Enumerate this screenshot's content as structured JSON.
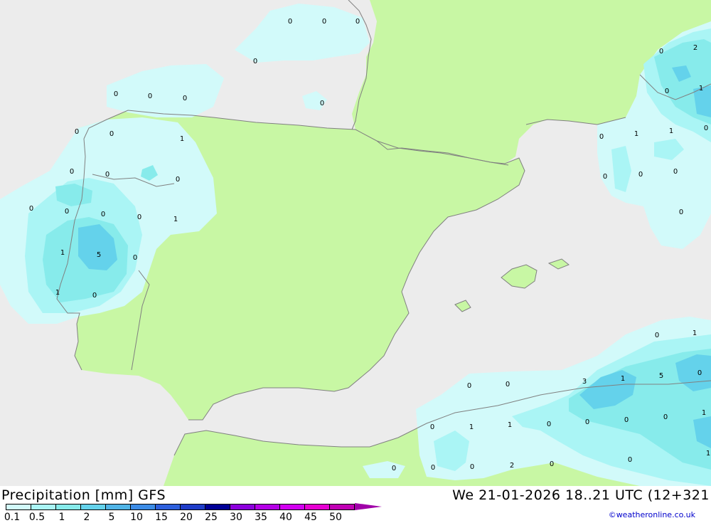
{
  "map": {
    "product_title": "Precipitation [mm] GFS",
    "valid_time": "We 21-01-2026 18..21 UTC (12+321",
    "credit": "©weatheronline.co.uk",
    "colors": {
      "sea": "#ececec",
      "land": "#c8f7a4",
      "border": "#808080",
      "precip_0_1": "#d2fafa",
      "precip_0_5": "#aaf5f5",
      "precip_1": "#87ebeb",
      "precip_2": "#64d2eb",
      "precip_5": "#50b4e6"
    },
    "legend": {
      "labels": [
        "0.1",
        "0.5",
        "1",
        "2",
        "5",
        "10",
        "15",
        "20",
        "25",
        "30",
        "35",
        "40",
        "45",
        "50"
      ],
      "colors": [
        "#d2fafa",
        "#aaf5f5",
        "#87ebeb",
        "#64d2eb",
        "#50b4e6",
        "#3c8ce6",
        "#2d5fdc",
        "#1e3cc8",
        "#000096",
        "#8c00dc",
        "#b400e6",
        "#d200f0",
        "#e600d2",
        "#c000b4"
      ]
    },
    "point_values": [
      "0",
      "0",
      "0",
      "0",
      "2",
      "0",
      "1",
      "0",
      "0",
      "0",
      "0",
      "0",
      "0",
      "0",
      "1",
      "0",
      "1",
      "1",
      "0",
      "0",
      "0",
      "0",
      "0",
      "0",
      "0",
      "0",
      "0",
      "0",
      "0",
      "1",
      "5",
      "0",
      "1",
      "0",
      "1",
      "0",
      "0",
      "1",
      "3",
      "1",
      "5",
      "0",
      "0",
      "0",
      "1",
      "0",
      "1",
      "1",
      "0",
      "0",
      "0",
      "0",
      "0",
      "0",
      "0",
      "2",
      "0",
      "1",
      "0"
    ]
  }
}
